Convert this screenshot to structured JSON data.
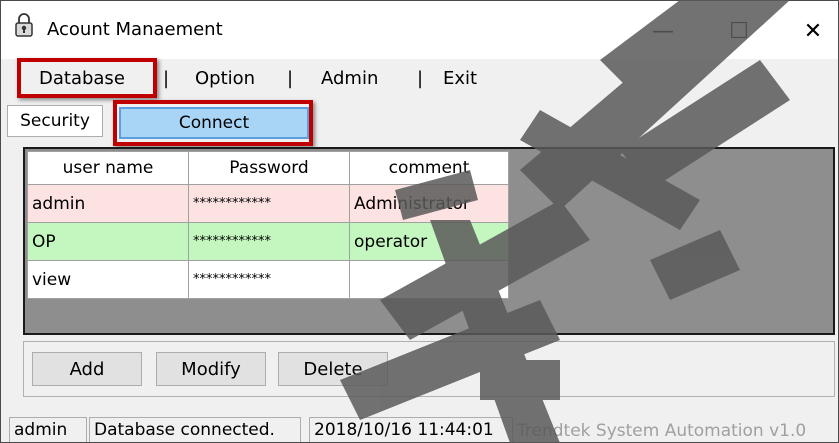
{
  "window": {
    "title": "Acount Manaement",
    "controls": {
      "minimize": "—",
      "maximize": "☐",
      "close": "✕"
    }
  },
  "menu": {
    "items": [
      "Database",
      "Option",
      "Admin",
      "Exit"
    ],
    "separator": "|"
  },
  "tabs": {
    "security": "Security",
    "connect": "Connect"
  },
  "grid": {
    "columns": [
      "user name",
      "Password",
      "comment"
    ],
    "rows": [
      {
        "user": "admin",
        "password": "************",
        "comment": "Administrator"
      },
      {
        "user": "OP",
        "password": "************",
        "comment": "operator"
      },
      {
        "user": "view",
        "password": "************",
        "comment": ""
      }
    ]
  },
  "buttons": {
    "add": "Add",
    "modify": "Modify",
    "delete": "Delete"
  },
  "status": {
    "user": "admin",
    "message": "Database connected.",
    "datetime": "2018/10/16 11:44:01",
    "brand": "Trendtek System Automation v1.0"
  },
  "colors": {
    "highlight": "#c00000",
    "row_admin": "#fde2e2",
    "row_op": "#c4f7c0",
    "tab_active": "#a8d4f5"
  }
}
